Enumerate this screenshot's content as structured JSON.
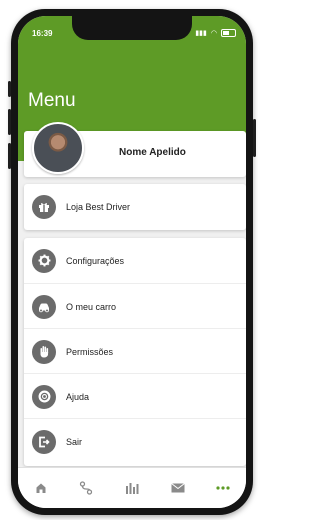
{
  "status_bar": {
    "time": "16:39"
  },
  "header": {
    "title": "Menu"
  },
  "profile": {
    "name": "Nome Apelido"
  },
  "store": {
    "label": "Loja Best Driver",
    "icon": "gift-icon"
  },
  "menu_items": [
    {
      "label": "Configurações",
      "icon": "gear-icon"
    },
    {
      "label": "O meu carro",
      "icon": "car-icon"
    },
    {
      "label": "Permissões",
      "icon": "hand-icon"
    },
    {
      "label": "Ajuda",
      "icon": "lifebuoy-icon"
    },
    {
      "label": "Sair",
      "icon": "logout-icon"
    }
  ],
  "tabbar": {
    "tabs": [
      {
        "icon": "home-icon",
        "active": false
      },
      {
        "icon": "route-icon",
        "active": false
      },
      {
        "icon": "stats-icon",
        "active": false
      },
      {
        "icon": "mail-icon",
        "active": false
      },
      {
        "icon": "more-icon",
        "active": true
      }
    ]
  },
  "colors": {
    "brand_green": "#5e9b26",
    "icon_gray": "#6b6b6b"
  }
}
